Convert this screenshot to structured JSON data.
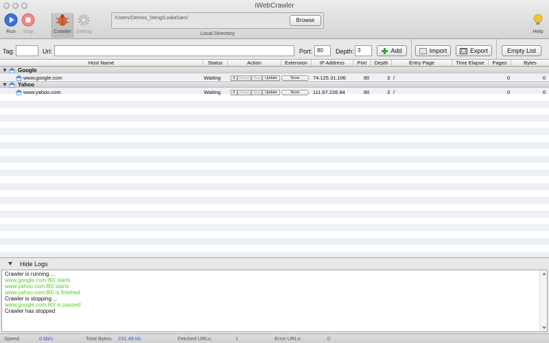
{
  "window": {
    "title": "iWebCrawler"
  },
  "toolbar": {
    "run_label": "Run",
    "stop_label": "Stop",
    "crawler_label": "Crawler",
    "setting_label": "Setting",
    "help_label": "Help",
    "local_dir_path": "/Users/Dennis_Deng/LoalaSam/",
    "browse_label": "Browse",
    "local_dir_label": "Local Directory"
  },
  "inputs": {
    "tag_label": "Tag:",
    "tag_value": "",
    "url_label": "Url:",
    "url_value": "",
    "port_label": "Port:",
    "port_value": "80",
    "depth_label": "Depth:",
    "depth_value": "3",
    "add_label": "Add",
    "import_label": "Import",
    "export_label": "Export",
    "empty_list_label": "Empty List"
  },
  "table": {
    "columns": [
      "Host Name",
      "Status",
      "Action",
      "Extension",
      "IP Address",
      "Port",
      "Depth",
      "Entry Page",
      "Time Elapse",
      "Pages",
      "Bytes"
    ],
    "action_buttons": [
      "X",
      "Reset",
      "Stop",
      "Update"
    ],
    "groups": [
      {
        "name": "Google",
        "rows": [
          {
            "host": "www.google.com",
            "status": "Waiting",
            "extension": "None",
            "ip": "74.125.31.106",
            "port": "80",
            "depth": "3",
            "entry": "/",
            "time": "",
            "pages": "0",
            "bytes": "0"
          }
        ]
      },
      {
        "name": "Yahoo",
        "rows": [
          {
            "host": "www.yahoo.com",
            "status": "Waiting",
            "extension": "None",
            "ip": "111.67.226.84",
            "port": "80",
            "depth": "3",
            "entry": "/",
            "time": "",
            "pages": "0",
            "bytes": "0"
          }
        ]
      }
    ]
  },
  "logs": {
    "toggle_label": "Hide Logs",
    "lines": [
      {
        "text": "Crawler is running ...",
        "color": "black"
      },
      {
        "text": "www.google.com:80/ starts",
        "color": "green"
      },
      {
        "text": "www.yahoo.com:80/ starts",
        "color": "green"
      },
      {
        "text": "www.yahoo.com:80/ is finished",
        "color": "green"
      },
      {
        "text": "Crawler is stopping ...",
        "color": "black"
      },
      {
        "text": "www.google.com:80/ is paused",
        "color": "green"
      },
      {
        "text": "Crawler has stopped",
        "color": "black"
      }
    ]
  },
  "status": {
    "speed_label": "Speed:",
    "speed_value": "0 kb/s",
    "total_label": "Total Bytes:",
    "total_value": "231.49 kb",
    "fetched_label": "Fetched URLs:",
    "fetched_value": "1",
    "error_label": "Error URLs:",
    "error_value": "0"
  },
  "colors": {
    "accent_blue": "#2f5fe0",
    "log_green": "#55cc22",
    "stripe": "#edf0f5"
  }
}
